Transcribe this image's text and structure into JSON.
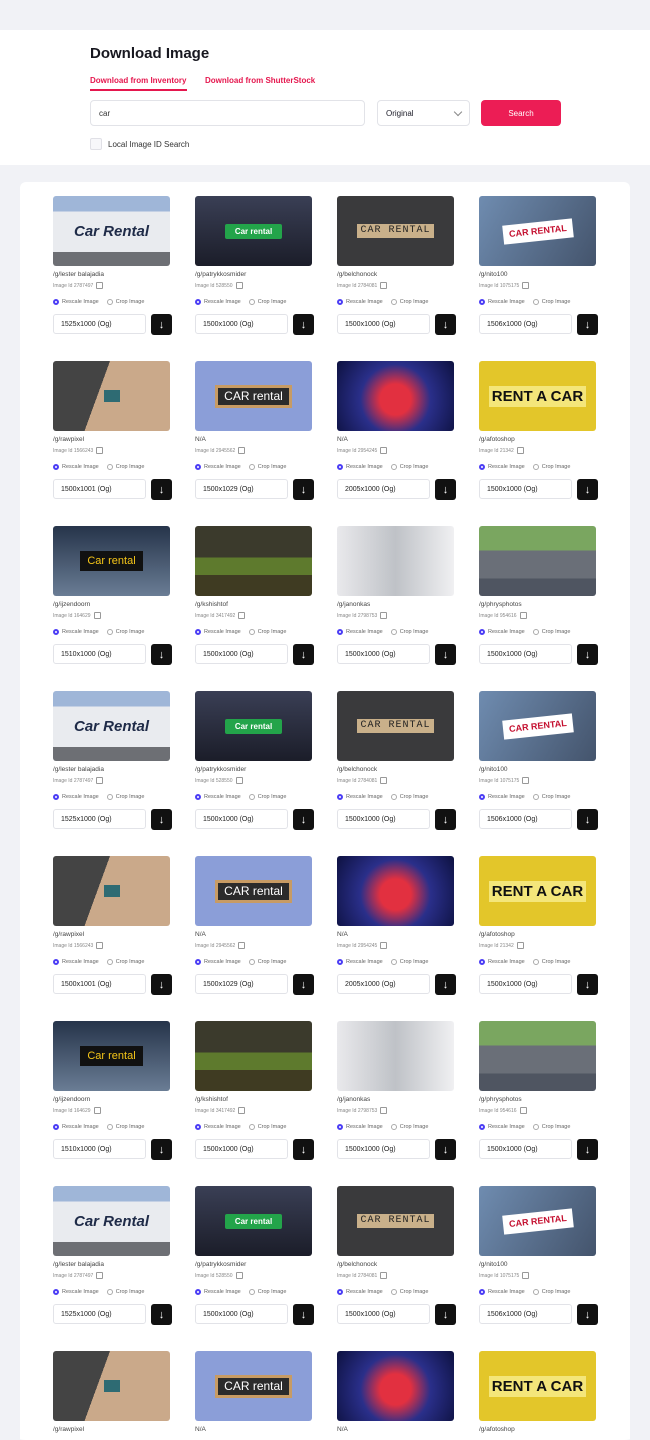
{
  "header": {
    "title": "Download Image",
    "tabs": [
      {
        "label": "Download from Inventory",
        "active": true
      },
      {
        "label": "Download from ShutterStock",
        "active": false
      }
    ],
    "search": {
      "value": "car",
      "placeholder": ""
    },
    "select": {
      "value": "Original"
    },
    "search_button": "Search",
    "local_search_label": "Local Image ID Search",
    "accent_color": "#ec1d55"
  },
  "card_labels": {
    "rescale": "Rescale Image",
    "crop": "Crop Image",
    "download_icon": "arrow-down-icon"
  },
  "rows": [
    [
      {
        "thumb": "t-car-rental",
        "text": "Car Rental",
        "author": "/g/lester balajadia",
        "id": "Image Id 2787497",
        "size": "1525x1000 (Og)"
      },
      {
        "thumb": "t-keyboard",
        "text": "Car rental",
        "author": "/g/patrykkosmider",
        "id": "Image Id 528550",
        "size": "1500x1000 (Og)"
      },
      {
        "thumb": "t-blocks",
        "text": "CAR RENTAL",
        "author": "/g/belchonock",
        "id": "Image Id 2784081",
        "size": "1500x1000 (Og)"
      },
      {
        "thumb": "t-sign",
        "text": "CAR RENTAL",
        "author": "/g/nito100",
        "id": "Image Id 1075175",
        "size": "1506x1000 (Og)"
      }
    ],
    [
      {
        "thumb": "t-laptop",
        "text": "",
        "author": "/g/rawpixel",
        "id": "Image Id 1566243",
        "size": "1500x1001 (Og)"
      },
      {
        "thumb": "t-chalk",
        "text": "CAR rental",
        "author": "N/A",
        "id": "Image Id 2945562",
        "size": "1500x1029 (Og)"
      },
      {
        "thumb": "t-sports",
        "text": "",
        "author": "N/A",
        "id": "Image Id 2954245",
        "size": "2005x1000 (Og)"
      },
      {
        "thumb": "t-rent",
        "text": "RENT A CAR",
        "author": "/g/afotoshop",
        "id": "Image Id 21342",
        "size": "1500x1000 (Og)"
      }
    ],
    [
      {
        "thumb": "t-airport",
        "text": "Car rental",
        "author": "/g/ijzendoorn",
        "id": "Image Id 164629",
        "size": "1510x1000 (Og)"
      },
      {
        "thumb": "t-field",
        "text": "",
        "author": "/g/kshishtof",
        "id": "Image Id 3417492",
        "size": "1500x1000 (Og)"
      },
      {
        "thumb": "t-garage",
        "text": "",
        "author": "/g/janonkas",
        "id": "Image Id 2798753",
        "size": "1500x1000 (Og)"
      },
      {
        "thumb": "t-lot",
        "text": "",
        "author": "/g/phrysphotos",
        "id": "Image Id 954616",
        "size": "1500x1000 (Og)"
      }
    ],
    [
      {
        "thumb": "t-car-rental",
        "text": "Car Rental",
        "author": "/g/lester balajadia",
        "id": "Image Id 2787497",
        "size": "1525x1000 (Og)"
      },
      {
        "thumb": "t-keyboard",
        "text": "Car rental",
        "author": "/g/patrykkosmider",
        "id": "Image Id 528550",
        "size": "1500x1000 (Og)"
      },
      {
        "thumb": "t-blocks",
        "text": "CAR RENTAL",
        "author": "/g/belchonock",
        "id": "Image Id 2784081",
        "size": "1500x1000 (Og)"
      },
      {
        "thumb": "t-sign",
        "text": "CAR RENTAL",
        "author": "/g/nito100",
        "id": "Image Id 1075175",
        "size": "1506x1000 (Og)"
      }
    ],
    [
      {
        "thumb": "t-laptop",
        "text": "",
        "author": "/g/rawpixel",
        "id": "Image Id 1566243",
        "size": "1500x1001 (Og)"
      },
      {
        "thumb": "t-chalk",
        "text": "CAR rental",
        "author": "N/A",
        "id": "Image Id 2945562",
        "size": "1500x1029 (Og)"
      },
      {
        "thumb": "t-sports",
        "text": "",
        "author": "N/A",
        "id": "Image Id 2954245",
        "size": "2005x1000 (Og)"
      },
      {
        "thumb": "t-rent",
        "text": "RENT A CAR",
        "author": "/g/afotoshop",
        "id": "Image Id 21342",
        "size": "1500x1000 (Og)"
      }
    ],
    [
      {
        "thumb": "t-airport",
        "text": "Car rental",
        "author": "/g/ijzendoorn",
        "id": "Image Id 164629",
        "size": "1510x1000 (Og)"
      },
      {
        "thumb": "t-field",
        "text": "",
        "author": "/g/kshishtof",
        "id": "Image Id 3417492",
        "size": "1500x1000 (Og)"
      },
      {
        "thumb": "t-garage",
        "text": "",
        "author": "/g/janonkas",
        "id": "Image Id 2798753",
        "size": "1500x1000 (Og)"
      },
      {
        "thumb": "t-lot",
        "text": "",
        "author": "/g/phrysphotos",
        "id": "Image Id 954616",
        "size": "1500x1000 (Og)"
      }
    ],
    [
      {
        "thumb": "t-car-rental",
        "text": "Car Rental",
        "author": "/g/lester balajadia",
        "id": "Image Id 2787497",
        "size": "1525x1000 (Og)"
      },
      {
        "thumb": "t-keyboard",
        "text": "Car rental",
        "author": "/g/patrykkosmider",
        "id": "Image Id 528550",
        "size": "1500x1000 (Og)"
      },
      {
        "thumb": "t-blocks",
        "text": "CAR RENTAL",
        "author": "/g/belchonock",
        "id": "Image Id 2784081",
        "size": "1500x1000 (Og)"
      },
      {
        "thumb": "t-sign",
        "text": "CAR RENTAL",
        "author": "/g/nito100",
        "id": "Image Id 1075175",
        "size": "1506x1000 (Og)"
      }
    ],
    [
      {
        "thumb": "t-laptop",
        "text": "",
        "author": "/g/rawpixel",
        "id": "",
        "size": ""
      },
      {
        "thumb": "t-chalk",
        "text": "CAR rental",
        "author": "N/A",
        "id": "",
        "size": ""
      },
      {
        "thumb": "t-sports",
        "text": "",
        "author": "N/A",
        "id": "",
        "size": ""
      },
      {
        "thumb": "t-rent",
        "text": "RENT A CAR",
        "author": "/g/afotoshop",
        "id": "",
        "size": ""
      }
    ]
  ]
}
